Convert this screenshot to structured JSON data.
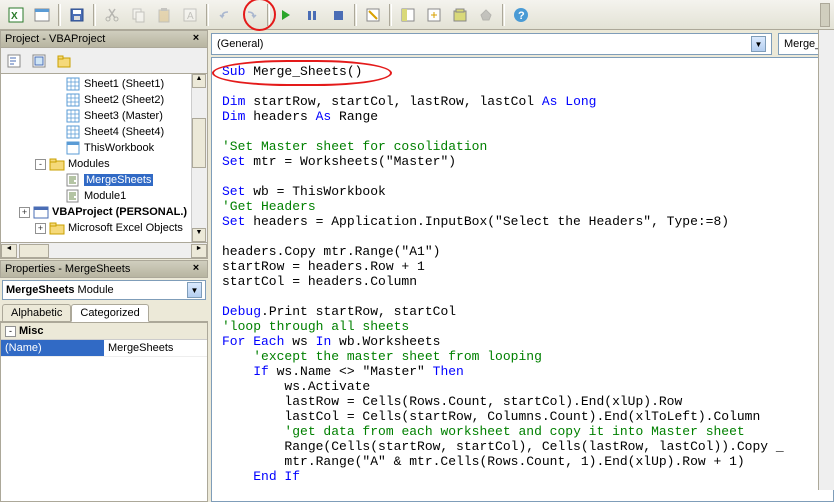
{
  "toolbar": {
    "icons": [
      "excel",
      "word",
      "save",
      "cut",
      "copy",
      "paste",
      "find",
      "undo",
      "redo",
      "run",
      "pause",
      "stop",
      "design",
      "project",
      "explorer",
      "props",
      "browser",
      "toolbox",
      "help"
    ]
  },
  "project_panel": {
    "title": "Project - VBAProject",
    "tree": [
      {
        "level": 3,
        "icon": "sheet",
        "label": "Sheet1 (Sheet1)"
      },
      {
        "level": 3,
        "icon": "sheet",
        "label": "Sheet2 (Sheet2)"
      },
      {
        "level": 3,
        "icon": "sheet",
        "label": "Sheet3 (Master)"
      },
      {
        "level": 3,
        "icon": "sheet",
        "label": "Sheet4 (Sheet4)"
      },
      {
        "level": 3,
        "icon": "workbook",
        "label": "ThisWorkbook"
      },
      {
        "level": 2,
        "expander": "-",
        "icon": "folder",
        "label": "Modules"
      },
      {
        "level": 3,
        "icon": "module",
        "label": "MergeSheets",
        "selected": true
      },
      {
        "level": 3,
        "icon": "module",
        "label": "Module1"
      },
      {
        "level": 1,
        "expander": "+",
        "icon": "vba",
        "label": "VBAProject (PERSONAL.)",
        "bold": true
      },
      {
        "level": 2,
        "expander": "+",
        "icon": "folder",
        "label": "Microsoft Excel Objects",
        "truncated": true
      }
    ]
  },
  "properties_panel": {
    "title": "Properties - MergeSheets",
    "combo_name": "MergeSheets",
    "combo_type": "Module",
    "tabs": [
      "Alphabetic",
      "Categorized"
    ],
    "active_tab": 1,
    "category": "Misc",
    "rows": [
      {
        "name": "(Name)",
        "value": "MergeSheets"
      }
    ]
  },
  "code_panel": {
    "left_combo": "(General)",
    "right_combo": "Merge_",
    "code_lines": [
      {
        "t": "Sub",
        "c": "kw",
        "a": " Merge_Sheets()"
      },
      {
        "blank": true
      },
      {
        "t": "Dim",
        "c": "kw",
        "a": " startRow, startCol, lastRow, lastCol ",
        "t2": "As Long",
        "c2": "kw"
      },
      {
        "t": "Dim",
        "c": "kw",
        "a": " headers ",
        "t2": "As",
        "c2": "kw",
        "a2": " Range"
      },
      {
        "blank": true
      },
      {
        "full": "'Set Master sheet for cosolidation",
        "c": "cm"
      },
      {
        "t": "Set",
        "c": "kw",
        "a": " mtr = Worksheets(\"Master\")"
      },
      {
        "blank": true
      },
      {
        "t": "Set",
        "c": "kw",
        "a": " wb = ThisWorkbook"
      },
      {
        "full": "'Get Headers",
        "c": "cm"
      },
      {
        "t": "Set",
        "c": "kw",
        "a": " headers = Application.InputBox(\"Select the Headers\", Type:=8)"
      },
      {
        "blank": true
      },
      {
        "a": "headers.Copy mtr.Range(\"A1\")"
      },
      {
        "a": "startRow = headers.Row + 1"
      },
      {
        "a": "startCol = headers.Column"
      },
      {
        "blank": true
      },
      {
        "t": "Debug",
        "c": "kw",
        "a": ".Print startRow, startCol"
      },
      {
        "full": "'loop through all sheets",
        "c": "cm"
      },
      {
        "t": "For Each",
        "c": "kw",
        "a": " ws ",
        "t2": "In",
        "c2": "kw",
        "a2": " wb.Worksheets"
      },
      {
        "indent": 1,
        "full": "'except the master sheet from looping",
        "c": "cm"
      },
      {
        "indent": 1,
        "t": "If",
        "c": "kw",
        "a": " ws.Name <> \"Master\" ",
        "t2": "Then",
        "c2": "kw"
      },
      {
        "indent": 2,
        "a": "ws.Activate"
      },
      {
        "indent": 2,
        "a": "lastRow = Cells(Rows.Count, startCol).End(xlUp).Row"
      },
      {
        "indent": 2,
        "a": "lastCol = Cells(startRow, Columns.Count).End(xlToLeft).Column"
      },
      {
        "indent": 2,
        "full": "'get data from each worksheet and copy it into Master sheet",
        "c": "cm"
      },
      {
        "indent": 2,
        "a": "Range(Cells(startRow, startCol), Cells(lastRow, lastCol)).Copy _"
      },
      {
        "indent": 2,
        "a": "mtr.Range(\"A\" & mtr.Cells(Rows.Count, 1).End(xlUp).Row + 1)"
      },
      {
        "indent": 1,
        "t": "End If",
        "c": "kw"
      }
    ]
  }
}
